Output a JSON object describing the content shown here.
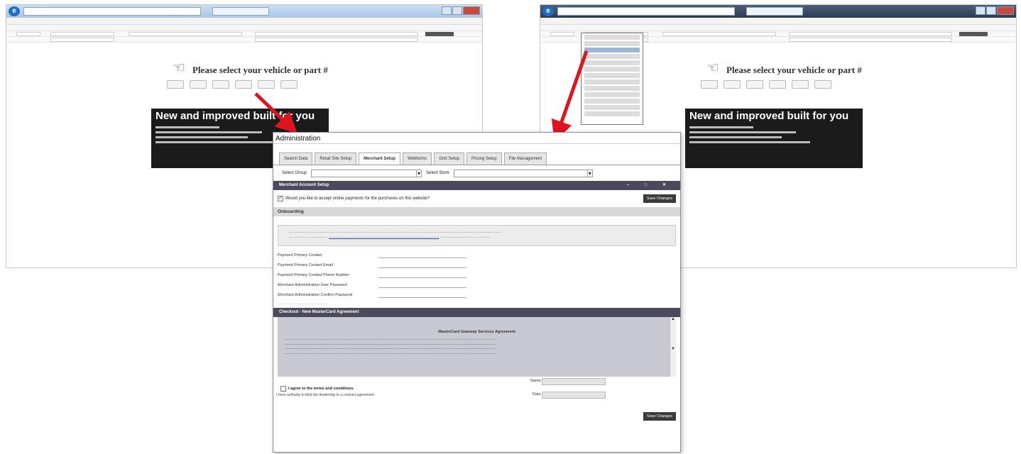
{
  "left_window": {
    "prompt": "Please select your vehicle or part #",
    "promo_heading": "New and improved built for you"
  },
  "right_window": {
    "prompt": "Please select your vehicle or part #",
    "promo_heading": "New and improved built for you"
  },
  "dialog": {
    "title": "Administration",
    "tabs": [
      "Search Data",
      "Retail Site Setup",
      "Merchant Setup",
      "Webforms",
      "Grid Setup",
      "Pricing Setup",
      "File Management"
    ],
    "active_tab_index": 2,
    "select_group_label": "Select Group",
    "select_store_label": "Select Store",
    "merchant_bar": "Merchant Account Setup",
    "online_payments_checked": true,
    "online_payments_label": "Would you like to accept online payments for the purchases on this website?",
    "save_changes": "Save Changes",
    "onboarding": "Onboarding",
    "fields": [
      "Payment Primary Contact",
      "Payment Primary Contact Email",
      "Payment Primary Contact Phone Number",
      "Merchant Administration User Password",
      "Merchant Administration Confirm Password"
    ],
    "agreement_bar": "Checkout - New MasterCard Agreement",
    "agreement_title": "MasterCard Gateway Services Agreement",
    "agree_label": "I agree to the terms and conditions.",
    "agree_sub": "I have authority to bind the dealership to a contract agreement.",
    "name_label": "Name",
    "date_label": "Date"
  }
}
